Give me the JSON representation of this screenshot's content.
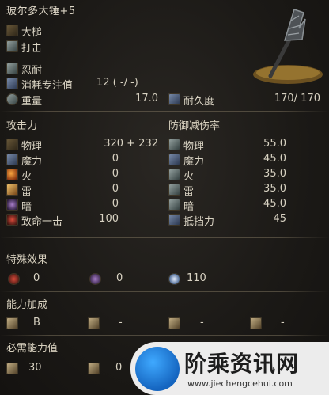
{
  "header": {
    "title": "玻尔多大锤+5",
    "weapon_type": "大槌",
    "attack_type": "打击",
    "skill": "忍耐",
    "fp_cost_label": "消耗专注值",
    "fp_cost_value": "12 (   -/   -)",
    "weight_label": "重量",
    "weight_value": "17.0",
    "durability_label": "耐久度",
    "durability_value": "170/  170"
  },
  "attack": {
    "heading": "攻击力",
    "rows": [
      {
        "label": "物理",
        "value": "320 +  232",
        "icon": "physical-icon"
      },
      {
        "label": "魔力",
        "value": "0",
        "icon": "magic-icon"
      },
      {
        "label": "火",
        "value": "0",
        "icon": "fire-icon"
      },
      {
        "label": "雷",
        "value": "0",
        "icon": "lightning-icon"
      },
      {
        "label": "暗",
        "value": "0",
        "icon": "dark-icon"
      },
      {
        "label": "致命一击",
        "value": "100",
        "icon": "critical-icon"
      }
    ]
  },
  "defense": {
    "heading": "防御减伤率",
    "rows": [
      {
        "label": "物理",
        "value": "55.0",
        "icon": "physical-guard-icon"
      },
      {
        "label": "魔力",
        "value": "45.0",
        "icon": "magic-guard-icon"
      },
      {
        "label": "火",
        "value": "35.0",
        "icon": "fire-guard-icon"
      },
      {
        "label": "雷",
        "value": "35.0",
        "icon": "lightning-guard-icon"
      },
      {
        "label": "暗",
        "value": "45.0",
        "icon": "dark-guard-icon"
      },
      {
        "label": "抵挡力",
        "value": "45",
        "icon": "stability-icon"
      }
    ]
  },
  "special": {
    "heading": "特殊效果",
    "items": [
      {
        "value": "0",
        "icon": "bleed-icon"
      },
      {
        "value": "0",
        "icon": "poison-icon"
      },
      {
        "value": "110",
        "icon": "frost-icon"
      }
    ]
  },
  "scaling": {
    "heading": "能力加成",
    "items": [
      {
        "value": "B",
        "icon": "strength-icon"
      },
      {
        "value": "-",
        "icon": "dexterity-icon"
      },
      {
        "value": "-",
        "icon": "intelligence-icon"
      },
      {
        "value": "-",
        "icon": "faith-icon"
      }
    ]
  },
  "requirements": {
    "heading": "必需能力值",
    "items": [
      {
        "value": "30",
        "icon": "strength-req-icon"
      },
      {
        "value": "0",
        "icon": "dexterity-req-icon"
      }
    ]
  },
  "watermark": {
    "text": "阶乘资讯网",
    "url": "www.jiechengcehui.com"
  },
  "colors": {
    "background": "#1b1916",
    "text": "#d8d2c2",
    "divider": "#786e5a"
  }
}
